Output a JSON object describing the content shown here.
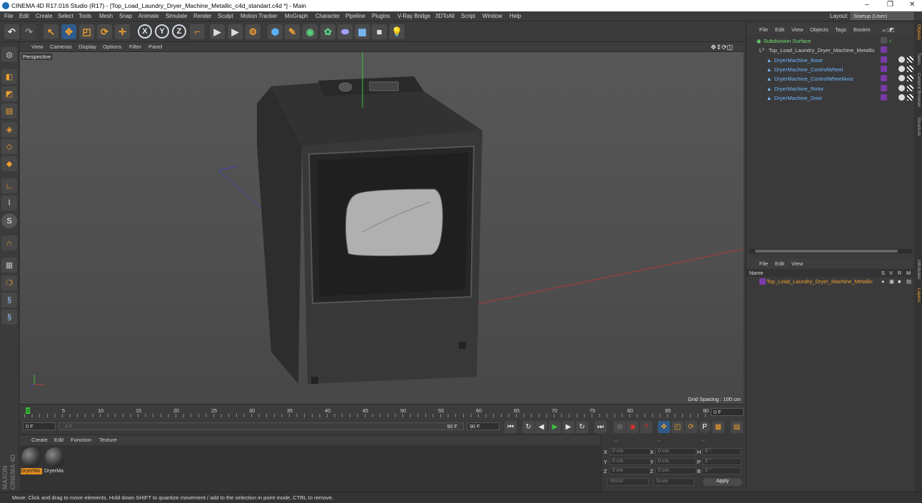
{
  "window": {
    "title": "CINEMA 4D R17.016 Studio (R17) - [Top_Load_Laundry_Dryer_Machine_Metallic_c4d_standart.c4d *] - Main",
    "controls": [
      "–",
      "❐",
      "✕"
    ]
  },
  "menubar": {
    "items": [
      "File",
      "Edit",
      "Create",
      "Select",
      "Tools",
      "Mesh",
      "Snap",
      "Animate",
      "Simulate",
      "Render",
      "Sculpt",
      "Motion Tracker",
      "MoGraph",
      "Character",
      "Pipeline",
      "Plugins",
      "V-Ray Bridge",
      "3DToAll",
      "Script",
      "Window",
      "Help"
    ],
    "layout_label": "Layout:",
    "layout_value": "Startup (User)"
  },
  "toolbar": {
    "axis_labels": [
      "X",
      "Y",
      "Z"
    ]
  },
  "viewport": {
    "menu": [
      "View",
      "Cameras",
      "Display",
      "Options",
      "Filter",
      "Panel"
    ],
    "camera_label": "Perspective",
    "grid_spacing": "Grid Spacing : 100 cm"
  },
  "timeline": {
    "ticks": [
      "0",
      "5",
      "10",
      "15",
      "20",
      "25",
      "30",
      "35",
      "40",
      "45",
      "50",
      "55",
      "60",
      "65",
      "70",
      "75",
      "80",
      "85",
      "90"
    ],
    "end_frame": "0 F"
  },
  "transport": {
    "current_frame": "0 F",
    "start_field": "0 F",
    "range_end": "90 F",
    "end_field": "90 F"
  },
  "material_panel": {
    "menu": [
      "Create",
      "Edit",
      "Function",
      "Texture"
    ],
    "materials": [
      {
        "name": "DryerMa",
        "selected": true
      },
      {
        "name": "DryerMa",
        "selected": false
      }
    ],
    "branding": "MAXON CINEMA 4D"
  },
  "coordinates": {
    "header": [
      "--",
      "--",
      "--"
    ],
    "rows": [
      {
        "a": "X",
        "a_val": "0 cm",
        "b": "X",
        "b_val": "0 cm",
        "c": "H",
        "c_val": "0 °"
      },
      {
        "a": "Y",
        "a_val": "0 cm",
        "b": "Y",
        "b_val": "0 cm",
        "c": "P",
        "c_val": "0 °"
      },
      {
        "a": "Z",
        "a_val": "0 cm",
        "b": "Z",
        "b_val": "0 cm",
        "c": "B",
        "c_val": "0 °"
      }
    ],
    "mode": "World",
    "transform": "Scale",
    "apply": "Apply"
  },
  "object_manager": {
    "menu": [
      "File",
      "Edit",
      "View",
      "Objects",
      "Tags",
      "Bookm"
    ],
    "objects": [
      {
        "name": "Subdivision Surface",
        "color": "#6fe06f"
      },
      {
        "name": "Top_Load_Laundry_Dryer_Machine_Metallic",
        "color": "#cfcfcf"
      },
      {
        "name": "DryerMachine_Base",
        "color": "#6fb5ff"
      },
      {
        "name": "DryerMachine_ControlWheel",
        "color": "#6fb5ff"
      },
      {
        "name": "DryerMachine_ControlWheelAniz",
        "color": "#6fb5ff"
      },
      {
        "name": "DryerMachine_Rotor",
        "color": "#6fb5ff"
      },
      {
        "name": "DryerMachine_Door",
        "color": "#6fb5ff"
      }
    ]
  },
  "attribute_manager": {
    "menu": [
      "File",
      "Edit",
      "View"
    ],
    "columns": {
      "name": "Name",
      "s": "S",
      "v": "V",
      "r": "R",
      "m": "M"
    },
    "layer": "Top_Load_Laundry_Dryer_Machine_Metallic"
  },
  "right_tabs": [
    "Objects",
    "Takes",
    "Content Browser",
    "Structure",
    "Attributes",
    "Layers"
  ],
  "status": "Move: Click and drag to move elements. Hold down SHIFT to quantize movement / add to the selection in point mode, CTRL to remove."
}
